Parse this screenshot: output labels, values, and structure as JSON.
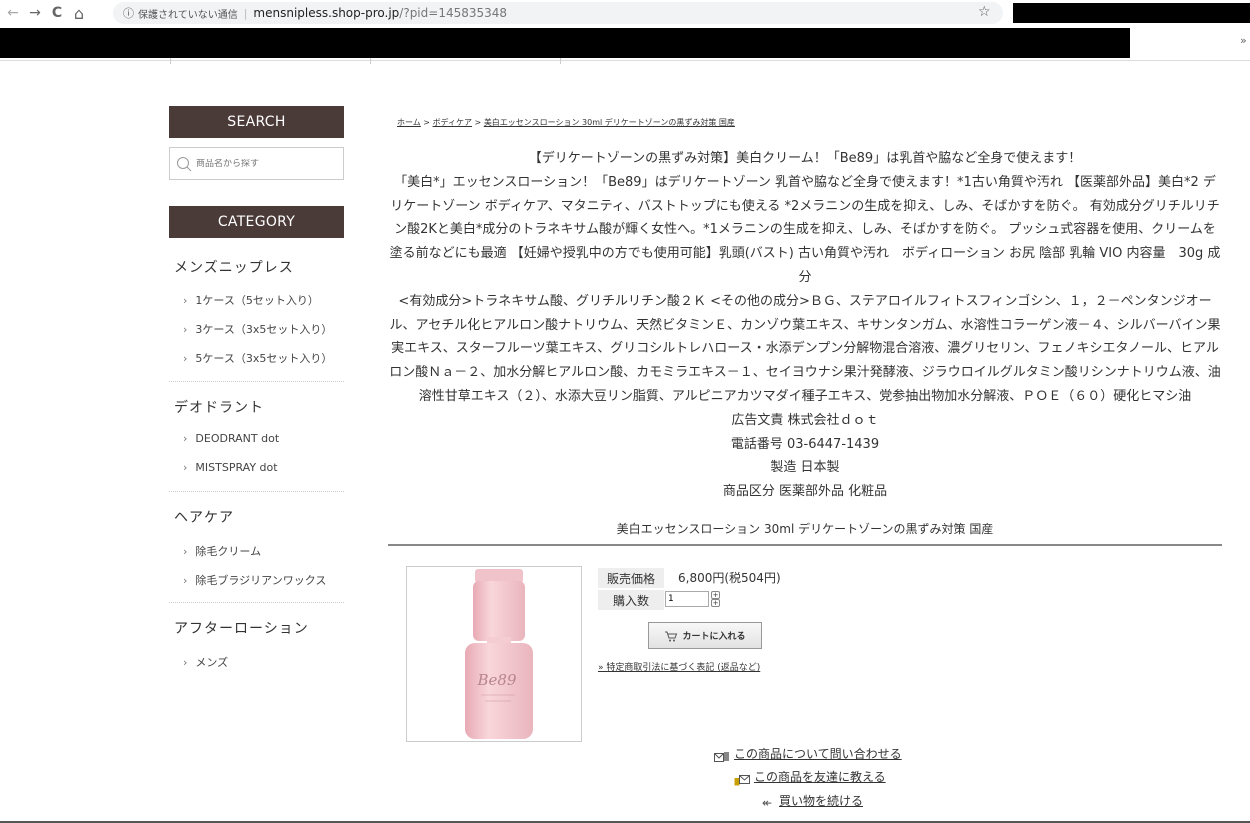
{
  "browser": {
    "back": "←",
    "forward": "→",
    "reload": "C",
    "home": "⌂",
    "info_icon": "ⓘ",
    "insecure": "保護されていない通信",
    "separator": "|",
    "domain": "mensnipless.shop-pro.jp",
    "path": "/?pid=145835348",
    "star": "☆",
    "more": "»"
  },
  "sidebar": {
    "search_title": "SEARCH",
    "search_placeholder": "商品名から探す",
    "category_title": "CATEGORY",
    "groups": [
      {
        "title": "メンズニップレス",
        "items": [
          "1ケース（5セット入り）",
          "3ケース（3x5セット入り）",
          "5ケース（3x5セット入り）"
        ]
      },
      {
        "title": "デオドラント",
        "items": [
          "DEODRANT dot",
          "MISTSPRAY dot"
        ]
      },
      {
        "title": "ヘアケア",
        "items": [
          "除毛クリーム",
          "除毛ブラジリアンワックス"
        ]
      },
      {
        "title": "アフターローション",
        "items": [
          "メンズ"
        ]
      }
    ],
    "arrow": "›"
  },
  "breadcrumb": {
    "home": "ホーム",
    "sep": " > ",
    "category": "ボディケア",
    "current": "美白エッセンスローション 30ml デリケートゾーンの黒ずみ対策 国産"
  },
  "description": {
    "headline": "【デリケートゾーンの黒ずみ対策】美白クリーム！「Be89」は乳首や脇など全身で使えます！",
    "body": "「美白*」エッセンスローション！「Be89」はデリケートゾーン 乳首や脇など全身で使えます！*1古い角質や汚れ 【医薬部外品】美白*2 デリケートゾーン ボディケア、マタニティ、バストトップにも使える *2メラニンの生成を抑え、しみ、そばかすを防ぐ。 有効成分グリチルリチン酸2Kと美白*成分のトラネキサム酸が輝く女性へ。*1メラニンの生成を抑え、しみ、そばかすを防ぐ。 プッシュ式容器を使用、クリームを塗る前などにも最適 【妊婦や授乳中の方でも使用可能】乳頭(バスト) 古い角質や汚れ　ボディローション お尻 陰部 乳輪 VIO 内容量　30g 成分",
    "ingredients": "<有効成分>トラネキサム酸、グリチルリチン酸２Ｋ <その他の成分>ＢＧ、ステアロイルフィトスフィンゴシン、１，２－ペンタンジオール、アセチル化ヒアルロン酸ナトリウム、天然ビタミンＥ、カンゾウ葉エキス、キサンタンガム、水溶性コラーゲン液－４、シルバーバイン果実エキス、スターフルーツ葉エキス、グリコシルトレハロース・水添デンプン分解物混合溶液、濃グリセリン、フェノキシエタノール、ヒアルロン酸Ｎａ－２、加水分解ヒアルロン酸、カモミラエキス－１、セイヨウナシ果汁発酵液、ジラウロイルグルタミン酸リシンナトリウム液、油溶性甘草エキス（２）、水添大豆リン脂質、アルピニアカツマダイ種子エキス、党参抽出物加水分解液、ＰＯＥ（６０）硬化ヒマシ油",
    "advertiser": "広告文責 株式会社ｄｏｔ",
    "phone": "電話番号 03-6447-1439",
    "made_in": "製造 日本製",
    "category": "商品区分 医薬部外品 化粧品"
  },
  "product": {
    "name": "美白エッセンスローション 30ml デリケートゾーンの黒ずみ対策 国産",
    "price_label": "販売価格",
    "price_value": "6,800円(税504円)",
    "qty_label": "購入数",
    "qty_value": "1",
    "stepper_up": "+",
    "stepper_down": "+",
    "cart_label": "カートに入れる",
    "tokutei_link": "» 特定商取引法に基づく表記 (返品など)",
    "bottle_brand": "Be89"
  },
  "links": {
    "inquire": "この商品について問い合わせる",
    "tell_friend": "この商品を友達に教える",
    "continue": "買い物を続ける",
    "continue_arrow": "↞"
  },
  "colors": {
    "sidebar_head_bg": "#4a3a38",
    "bottle_pink": "#f3c9cf"
  }
}
